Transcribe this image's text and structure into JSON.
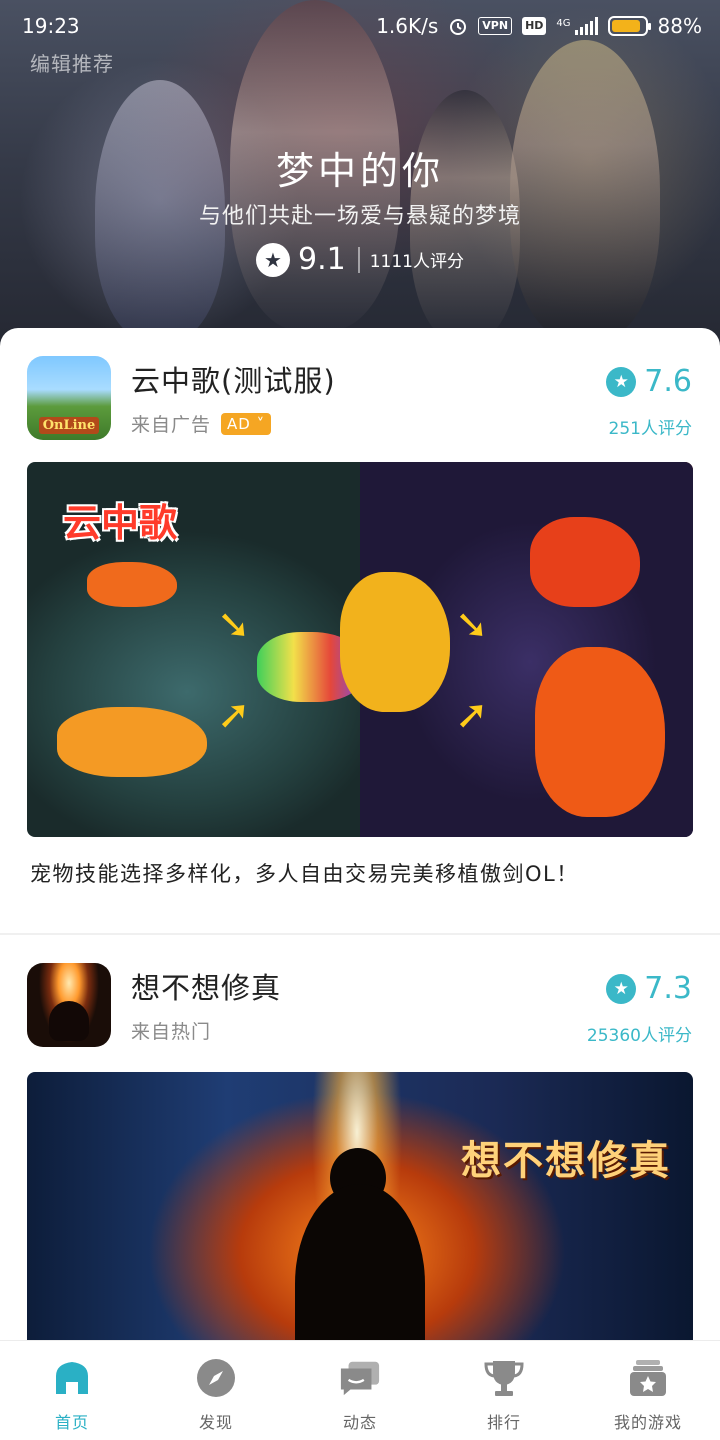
{
  "status_bar": {
    "time": "19:23",
    "speed": "1.6K/s",
    "vpn": "VPN",
    "hd": "HD",
    "network": "4G",
    "battery": "88%",
    "battery_level": 0.88
  },
  "hero": {
    "tag": "编辑推荐",
    "title": "梦中的你",
    "subtitle": "与他们共赴一场爱与悬疑的梦境",
    "score": "9.1",
    "rating_count": "1111人评分"
  },
  "cards": [
    {
      "name": "云中歌(测试服)",
      "source": "来自广告",
      "ad_badge": "AD",
      "score": "7.6",
      "rating_count": "251人评分",
      "banner_logo": "云中歌",
      "description": "宠物技能选择多样化，多人自由交易完美移植傲剑OL！",
      "icon_text": "OnLine"
    },
    {
      "name": "想不想修真",
      "source": "来自热门",
      "score": "7.3",
      "rating_count": "25360人评分",
      "banner_logo": "想不想修真"
    }
  ],
  "tabs": [
    {
      "label": "首页",
      "icon": "home-icon",
      "active": true
    },
    {
      "label": "发现",
      "icon": "compass-icon",
      "active": false
    },
    {
      "label": "动态",
      "icon": "chat-icon",
      "active": false
    },
    {
      "label": "排行",
      "icon": "trophy-icon",
      "active": false
    },
    {
      "label": "我的游戏",
      "icon": "my-games-icon",
      "active": false
    }
  ],
  "colors": {
    "accent": "#3bb8c8",
    "tab_active": "#2ab0c5",
    "ad_badge": "#f5a623",
    "battery": "#f3b21a"
  }
}
